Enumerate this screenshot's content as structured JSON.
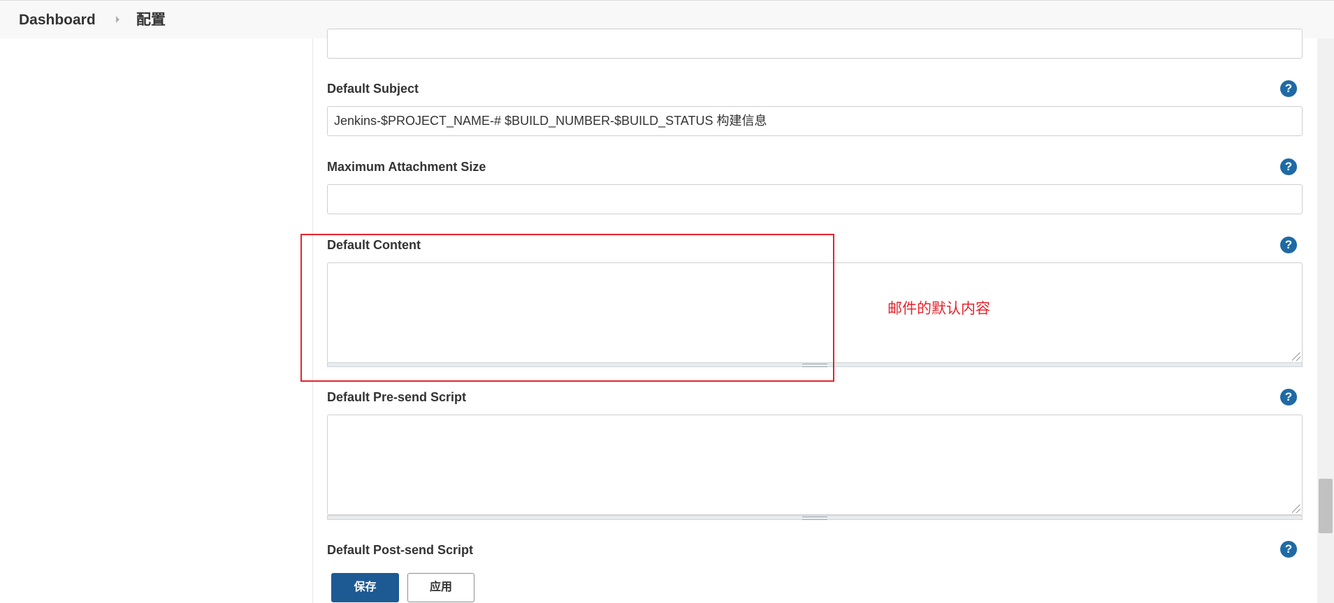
{
  "breadcrumb": {
    "dashboard": "Dashboard",
    "current": "配置"
  },
  "fields": {
    "default_subject": {
      "label": "Default Subject",
      "value": "Jenkins-$PROJECT_NAME-# $BUILD_NUMBER-$BUILD_STATUS 构建信息"
    },
    "max_attachment_size": {
      "label": "Maximum Attachment Size",
      "value": ""
    },
    "default_content": {
      "label": "Default Content",
      "value": ""
    },
    "pre_send_script": {
      "label": "Default Pre-send Script",
      "value": ""
    },
    "post_send_script": {
      "label": "Default Post-send Script"
    }
  },
  "help_icon_glyph": "?",
  "annotation": {
    "text": "邮件的默认内容",
    "color": "#e8222a"
  },
  "buttons": {
    "save": "保存",
    "apply": "应用"
  },
  "colors": {
    "primary_button": "#1d5a93",
    "help_icon": "#1f6aa5"
  }
}
